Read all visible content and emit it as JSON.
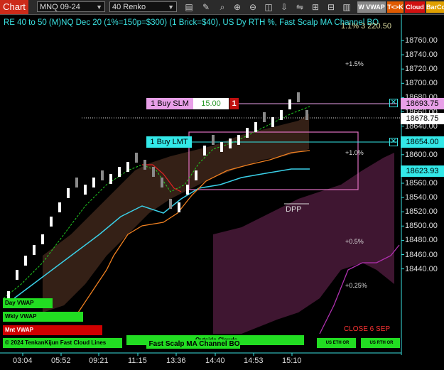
{
  "toolbar": {
    "app_label": "Chart",
    "instrument": "MNQ 09-24",
    "bar_type": "40 Renko",
    "icons": [
      "pencil-icon",
      "magnifier-icon",
      "zoom-in-icon",
      "zoom-out-icon",
      "layers-icon",
      "pointer-icon",
      "ruler-icon",
      "draw-icon",
      "bars-icon",
      "bookmark-icon"
    ],
    "wvwap_label": "W VWAP",
    "tk_label": "T<>K",
    "cloud_label": "Cloud",
    "barcolor_label": "BarCo"
  },
  "chart": {
    "title": "RE 40 to 50 (M)NQ Dec 20 (1%=150p=$300) (1 Brick=$40), US Dy RTH %, Fast Scalp MA Channel BO",
    "title_right": "1.1% 3 220.50",
    "price_labels": [
      "18760.00",
      "18740.00",
      "18720.00",
      "18700.00",
      "18680.00",
      "18660.00",
      "18640.00",
      "18620.00",
      "18600.00",
      "18580.00",
      "18560.00",
      "18540.00",
      "18520.00",
      "18500.00",
      "18480.00",
      "18460.00",
      "18440.00"
    ],
    "time_labels": [
      "03:04",
      "05:52",
      "09:21",
      "11:15",
      "13:36",
      "14:40",
      "14:53",
      "15:10"
    ],
    "pct_labels": [
      "+1.5%",
      "+1.0%",
      "+0.5%",
      "+0.25%"
    ],
    "close_label": "CLOSE 6 SEP",
    "dpp_label": "DPP",
    "order1": {
      "label": "1 Buy SLM",
      "qty": "15.00",
      "count": "1",
      "price": "18693.75"
    },
    "order2": {
      "label": "1 Buy LMT",
      "price": "18654.00"
    },
    "last_price": "18678.75",
    "ma_price": "18623.93",
    "bottom_badges": {
      "day_vwap": "Day VWAP",
      "wkly_vwap": "Wkly VWAP",
      "mnt_vwap": "Mnt VWAP",
      "ichi": "© 2024 TenkanKijun Fast Cloud Lines",
      "outside_clouds": "Outside Clouds",
      "fast_scalp": "Fast Scalp MA Channel BO",
      "us_eth_or": "US ETH OR",
      "us_rth_or": "US RTH OR"
    },
    "colors": {
      "accent": "#3ae0e0",
      "up_brick": "#ffffff",
      "down_brick": "#8a8a8a",
      "buy_slm": "#e8a0e8",
      "buy_lmt": "#33e8e8",
      "cloud_pink": "#4a1a3a",
      "badge_green": "#22dd22",
      "badge_red": "#d00000"
    }
  }
}
